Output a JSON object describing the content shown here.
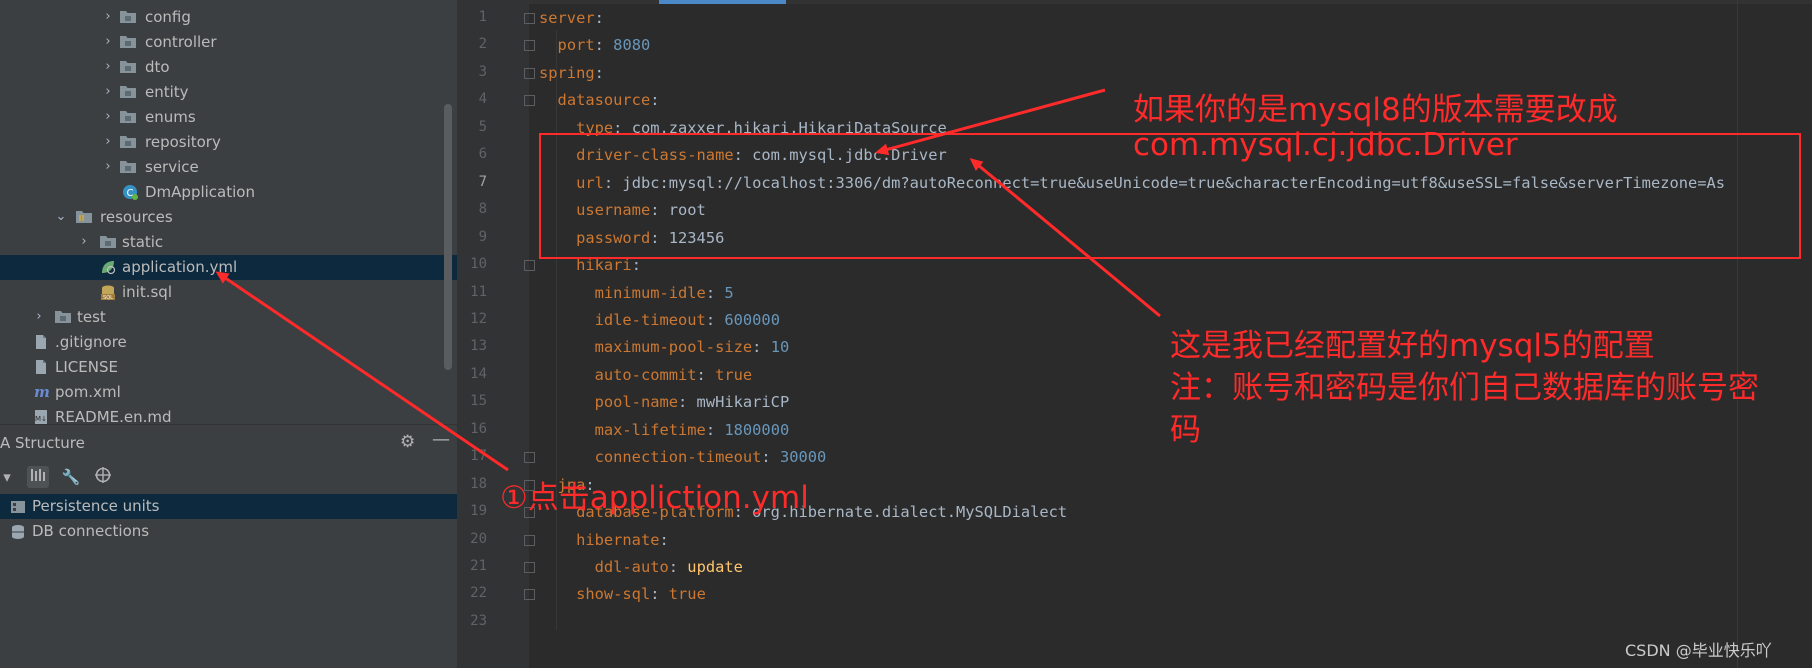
{
  "project_tree": [
    {
      "label": "config",
      "type": "folder",
      "expandable": true
    },
    {
      "label": "controller",
      "type": "folder",
      "expandable": true
    },
    {
      "label": "dto",
      "type": "folder",
      "expandable": true
    },
    {
      "label": "entity",
      "type": "folder",
      "expandable": true
    },
    {
      "label": "enums",
      "type": "folder",
      "expandable": true
    },
    {
      "label": "repository",
      "type": "folder",
      "expandable": true
    },
    {
      "label": "service",
      "type": "folder",
      "expandable": true
    },
    {
      "label": "DmApplication",
      "type": "class",
      "expandable": false
    },
    {
      "label": "resources",
      "type": "resources",
      "expandable": true,
      "expanded": true
    },
    {
      "label": "static",
      "type": "folder",
      "expandable": true
    },
    {
      "label": "application.yml",
      "type": "yml",
      "expandable": false,
      "selected": true
    },
    {
      "label": "init.sql",
      "type": "sql",
      "expandable": false
    },
    {
      "label": "test",
      "type": "folder",
      "expandable": true
    },
    {
      "label": ".gitignore",
      "type": "file",
      "expandable": false
    },
    {
      "label": "LICENSE",
      "type": "file",
      "expandable": false
    },
    {
      "label": "pom.xml",
      "type": "maven",
      "expandable": false
    },
    {
      "label": "README.en.md",
      "type": "md",
      "expandable": false
    }
  ],
  "structure_panel": {
    "title": "A Structure",
    "items": [
      {
        "label": "Persistence units",
        "selected": true
      },
      {
        "label": "DB connections",
        "selected": false
      }
    ]
  },
  "editor": {
    "current_line": 7,
    "lines": [
      {
        "n": "1",
        "code": [
          [
            "k",
            "server"
          ],
          [
            "v",
            ":"
          ]
        ]
      },
      {
        "n": "2",
        "code": [
          [
            "v",
            "  "
          ],
          [
            "k",
            "port"
          ],
          [
            "v",
            ": "
          ],
          [
            "n",
            "8080"
          ]
        ]
      },
      {
        "n": "3",
        "code": [
          [
            "k",
            "spring"
          ],
          [
            "v",
            ":"
          ]
        ]
      },
      {
        "n": "4",
        "code": [
          [
            "v",
            "  "
          ],
          [
            "k",
            "datasource"
          ],
          [
            "v",
            ":"
          ]
        ]
      },
      {
        "n": "5",
        "code": [
          [
            "v",
            "    "
          ],
          [
            "k",
            "type"
          ],
          [
            "v",
            ": com.zaxxer.hikari.HikariDataSource"
          ]
        ]
      },
      {
        "n": "6",
        "code": [
          [
            "v",
            "    "
          ],
          [
            "k",
            "driver-class-name"
          ],
          [
            "v",
            ": com.mysql.jdbc.Driver"
          ]
        ]
      },
      {
        "n": "7",
        "code": [
          [
            "v",
            "    "
          ],
          [
            "k",
            "url"
          ],
          [
            "v",
            ": jdbc:mysql://localhost:3306/dm?autoReconnect=true&useUnicode=true&characterEncoding=utf8&useSSL=false&serverTimezone=As"
          ]
        ]
      },
      {
        "n": "8",
        "code": [
          [
            "v",
            "    "
          ],
          [
            "k",
            "username"
          ],
          [
            "v",
            ": root"
          ]
        ]
      },
      {
        "n": "9",
        "code": [
          [
            "v",
            "    "
          ],
          [
            "k",
            "password"
          ],
          [
            "v",
            ": 123456"
          ]
        ]
      },
      {
        "n": "10",
        "code": [
          [
            "v",
            "    "
          ],
          [
            "k",
            "hikari"
          ],
          [
            "v",
            ":"
          ]
        ]
      },
      {
        "n": "11",
        "code": [
          [
            "v",
            "      "
          ],
          [
            "k",
            "minimum-idle"
          ],
          [
            "v",
            ": "
          ],
          [
            "n",
            "5"
          ]
        ]
      },
      {
        "n": "12",
        "code": [
          [
            "v",
            "      "
          ],
          [
            "k",
            "idle-timeout"
          ],
          [
            "v",
            ": "
          ],
          [
            "n",
            "600000"
          ]
        ]
      },
      {
        "n": "13",
        "code": [
          [
            "v",
            "      "
          ],
          [
            "k",
            "maximum-pool-size"
          ],
          [
            "v",
            ": "
          ],
          [
            "n",
            "10"
          ]
        ]
      },
      {
        "n": "14",
        "code": [
          [
            "v",
            "      "
          ],
          [
            "k",
            "auto-commit"
          ],
          [
            "v",
            ": "
          ],
          [
            "k",
            "true"
          ]
        ]
      },
      {
        "n": "15",
        "code": [
          [
            "v",
            "      "
          ],
          [
            "k",
            "pool-name"
          ],
          [
            "v",
            ": mwHikariCP"
          ]
        ]
      },
      {
        "n": "16",
        "code": [
          [
            "v",
            "      "
          ],
          [
            "k",
            "max-lifetime"
          ],
          [
            "v",
            ": "
          ],
          [
            "n",
            "1800000"
          ]
        ]
      },
      {
        "n": "17",
        "code": [
          [
            "v",
            "      "
          ],
          [
            "k",
            "connection-timeout"
          ],
          [
            "v",
            ": "
          ],
          [
            "n",
            "30000"
          ]
        ]
      },
      {
        "n": "18",
        "code": [
          [
            "v",
            "  "
          ],
          [
            "k",
            "jpa"
          ],
          [
            "v",
            ":"
          ]
        ]
      },
      {
        "n": "19",
        "code": [
          [
            "v",
            "    "
          ],
          [
            "k",
            "database-platform"
          ],
          [
            "v",
            ": org.hibernate.dialect.MySQLDialect"
          ]
        ]
      },
      {
        "n": "20",
        "code": [
          [
            "v",
            "    "
          ],
          [
            "k",
            "hibernate"
          ],
          [
            "v",
            ":"
          ]
        ]
      },
      {
        "n": "21",
        "code": [
          [
            "v",
            "      "
          ],
          [
            "k",
            "ddl-auto"
          ],
          [
            "v",
            ": "
          ],
          [
            "y",
            "update"
          ]
        ]
      },
      {
        "n": "22",
        "code": [
          [
            "v",
            "    "
          ],
          [
            "k",
            "show-sql"
          ],
          [
            "v",
            ": "
          ],
          [
            "k",
            "true"
          ]
        ]
      },
      {
        "n": "23",
        "code": []
      }
    ]
  },
  "annotations": {
    "mysql8_line1": "如果你的是mysql8的版本需要改成",
    "mysql8_line2": "com.mysql.cj.jdbc.Driver",
    "mysql5_line1": "这是我已经配置好的mysql5的配置",
    "mysql5_line2": "注：账号和密码是你们自己数据库的账号密",
    "mysql5_line3": "码",
    "click_hint": "①点击appliction.yml"
  },
  "watermark": "CSDN @毕业快乐吖",
  "colors": {
    "annotation_red": "#ff2a2a",
    "yaml_key": "#cc7832",
    "number": "#6897bb",
    "selection": "#0d293e"
  }
}
